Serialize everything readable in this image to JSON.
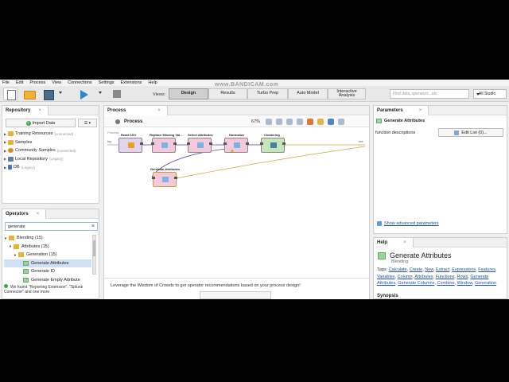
{
  "menu": [
    "File",
    "Edit",
    "Process",
    "View",
    "Connections",
    "Settings",
    "Extensions",
    "Help"
  ],
  "watermark": "www.BANDICAM.com",
  "toolbar": {
    "views_label": "Views:",
    "views": [
      {
        "label": "Design",
        "active": true
      },
      {
        "label": "Results",
        "active": false
      },
      {
        "label": "Turbo Prep",
        "active": false
      },
      {
        "label": "Auto Model",
        "active": false
      },
      {
        "label": "Interactive Analysis",
        "active": false
      }
    ],
    "search_placeholder": "Find data, operators...etc",
    "studio_select": "All Studio"
  },
  "repository": {
    "title": "Repository",
    "close": "×",
    "import_label": "Import Data",
    "items": [
      {
        "label": "Training Resources",
        "sub": "(connected)",
        "icon": "folder-icon"
      },
      {
        "label": "Samples",
        "sub": "",
        "icon": "folder-icon"
      },
      {
        "label": "Community Samples",
        "sub": "(connected)",
        "icon": "people-icon"
      },
      {
        "label": "Local Repository",
        "sub": "(Legacy)",
        "icon": "local-repo-icon"
      },
      {
        "label": "DB",
        "sub": "(Legacy)",
        "icon": "database-icon"
      }
    ]
  },
  "operators": {
    "title": "Operators",
    "close": "×",
    "search_value": "generate",
    "tree": [
      {
        "label": "Blending (15)",
        "indent": 0,
        "icon": "folder-icon",
        "selected": false
      },
      {
        "label": "Attributes (15)",
        "indent": 1,
        "icon": "folder-icon",
        "selected": false
      },
      {
        "label": "Generation (15)",
        "indent": 2,
        "icon": "folder-icon",
        "selected": false
      },
      {
        "label": "Generate Attributes",
        "indent": 3,
        "icon": "operator-icon",
        "selected": true
      },
      {
        "label": "Generate ID",
        "indent": 3,
        "icon": "operator-icon",
        "selected": false
      },
      {
        "label": "Generate Empty Attribute",
        "indent": 3,
        "icon": "operator-icon",
        "selected": false
      }
    ],
    "found_text": "We found \"Reporting Extension\", \"Splunk Connector\" and one more"
  },
  "process": {
    "title": "Process",
    "close": "×",
    "name": "Process",
    "zoom": "67%",
    "canvas_label": "Process",
    "operators": [
      {
        "name": "Read CSV",
        "color": "#e3d3ef",
        "glyph": "#e8a020",
        "warn": false
      },
      {
        "name": "Replace Missing Val...",
        "color": "#f4c9db",
        "glyph": "#7ab3e2",
        "warn": false
      },
      {
        "name": "Select Attributes",
        "color": "#f4c9db",
        "glyph": "#7ab3e2",
        "warn": false
      },
      {
        "name": "Normalize",
        "color": "#f4c9db",
        "glyph": "#7ab3e2",
        "warn": true
      },
      {
        "name": "Clustering",
        "color": "#c5e6b8",
        "glyph": "#4a7ca8",
        "warn": false
      },
      {
        "name": "Generate Attributes",
        "color": "#f4c9db",
        "glyph": "#7ab3e2",
        "warn": false
      }
    ],
    "wisdom_text": "Leverage the Wisdom of Crowds to get operator recommendations based on your process design!"
  },
  "parameters": {
    "title": "Parameters",
    "close": "×",
    "operator": "Generate Attributes",
    "param_label": "function descriptions",
    "edit_button": "Edit List (0)...",
    "advanced_link": "Show advanced parameters"
  },
  "help": {
    "title": "Help",
    "close": "×",
    "operator": "Generate Attributes",
    "group": "Blending",
    "tags_label": "Tags:",
    "tags": [
      "Calculate",
      "Create",
      "New",
      "Extract",
      "Expressions",
      "Features",
      "Variables",
      "Column",
      "Attributes",
      "Functions",
      "Rows",
      "Generate Attributes",
      "Generate Columns",
      "Combine",
      "Window",
      "Generation"
    ],
    "synopsis": "Synopsis"
  },
  "colors": {
    "accent": "#2a87d4",
    "link": "#1f4fa8",
    "selected": "#cfe0f5"
  }
}
